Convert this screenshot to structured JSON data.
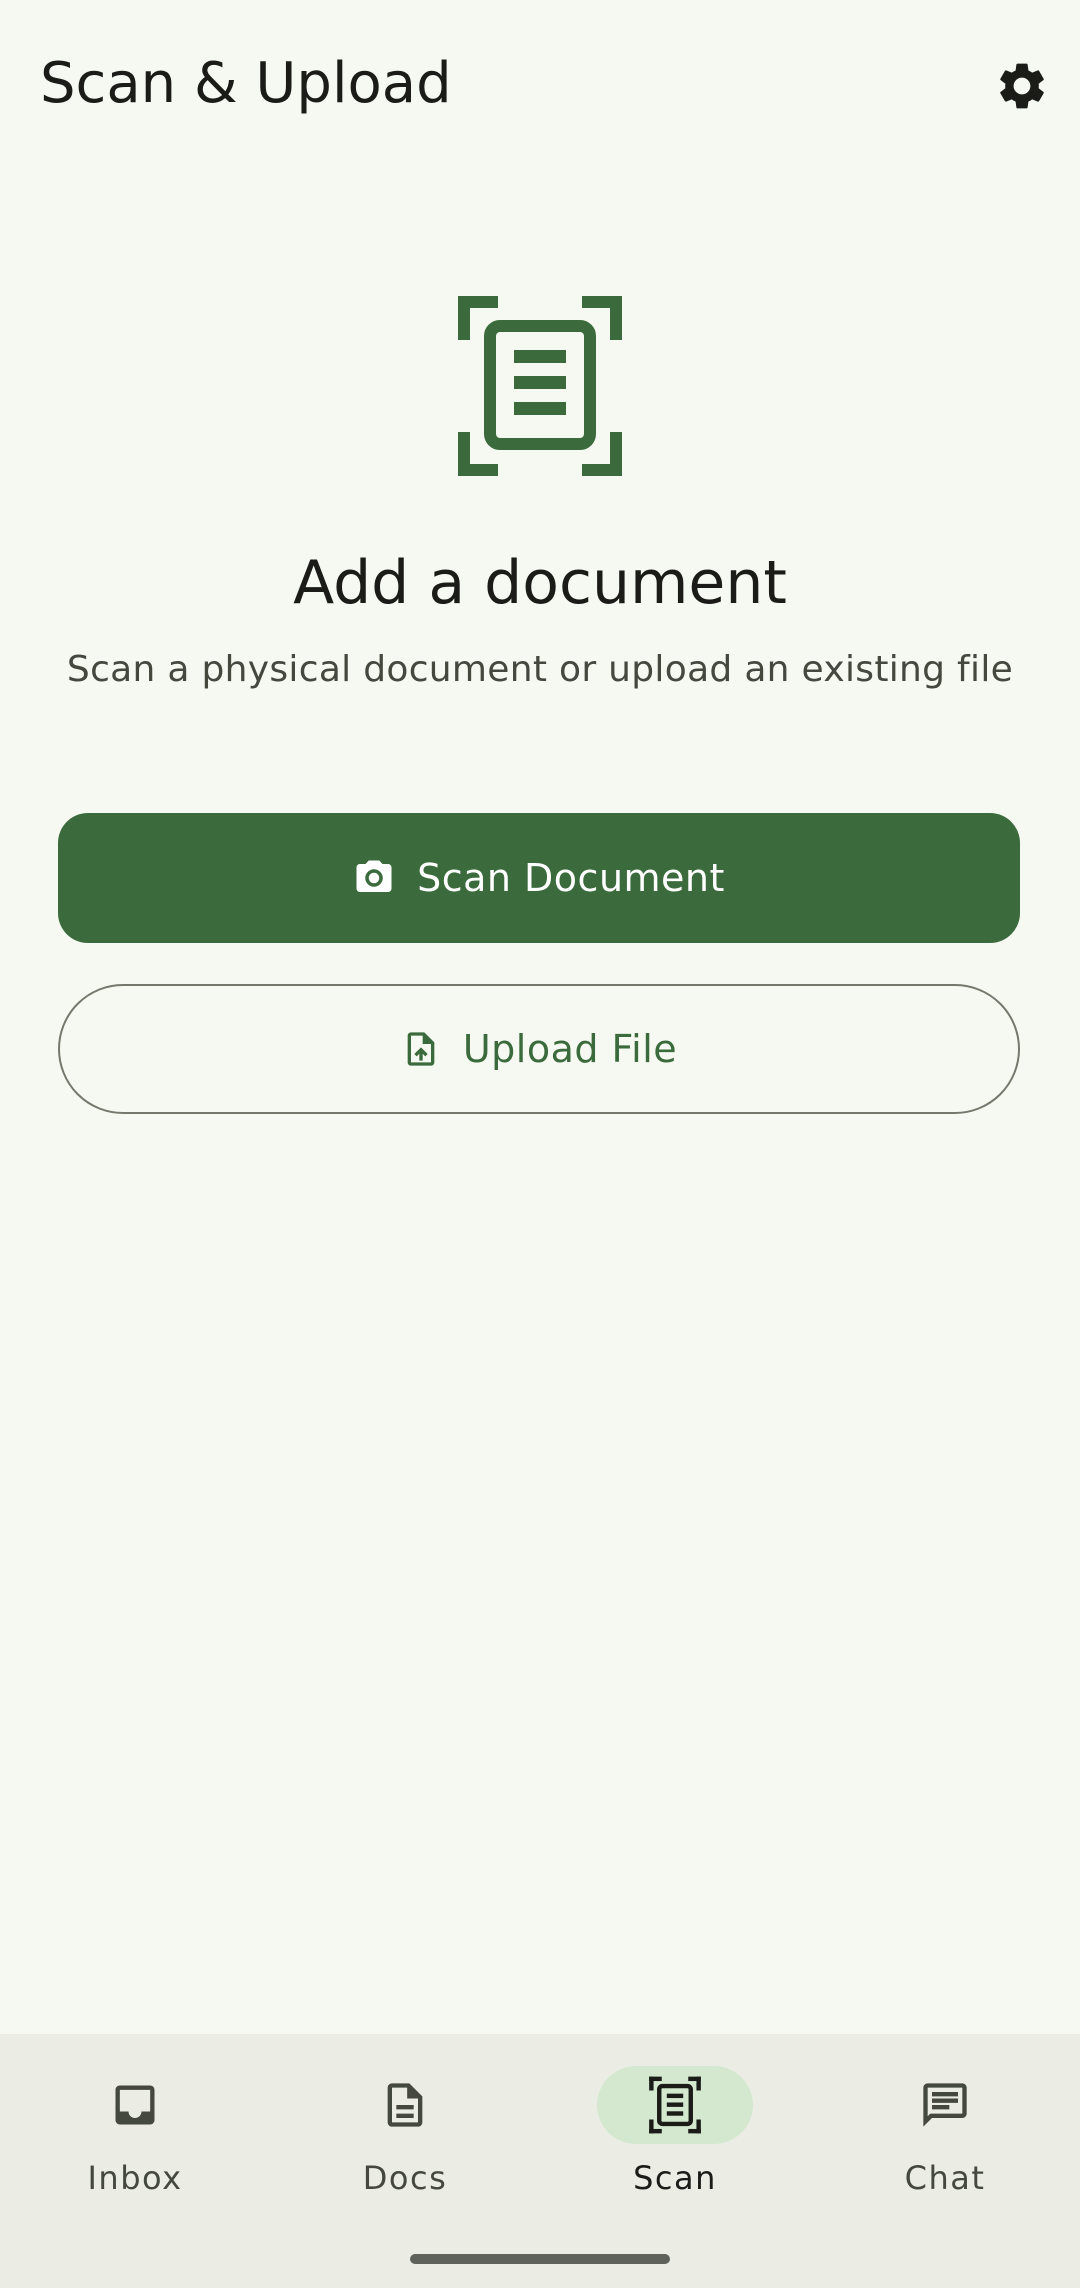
{
  "header": {
    "title": "Scan & Upload",
    "settings_icon": "gear-icon"
  },
  "main": {
    "hero_icon": "document-scanner-icon",
    "heading": "Add a document",
    "subtitle": "Scan a physical document or upload an existing file",
    "scan_button": {
      "label": "Scan Document",
      "icon": "camera-icon"
    },
    "upload_button": {
      "label": "Upload File",
      "icon": "upload-file-icon"
    }
  },
  "nav": {
    "items": [
      {
        "label": "Inbox",
        "icon": "inbox-icon",
        "active": false
      },
      {
        "label": "Docs",
        "icon": "document-icon",
        "active": false
      },
      {
        "label": "Scan",
        "icon": "document-scanner-icon",
        "active": true
      },
      {
        "label": "Chat",
        "icon": "chat-icon",
        "active": false
      }
    ]
  },
  "colors": {
    "background": "#f6f9f1",
    "primary": "#3b6b3c",
    "nav_background": "#ebede5",
    "nav_active_pill": "#d3e8cf"
  }
}
